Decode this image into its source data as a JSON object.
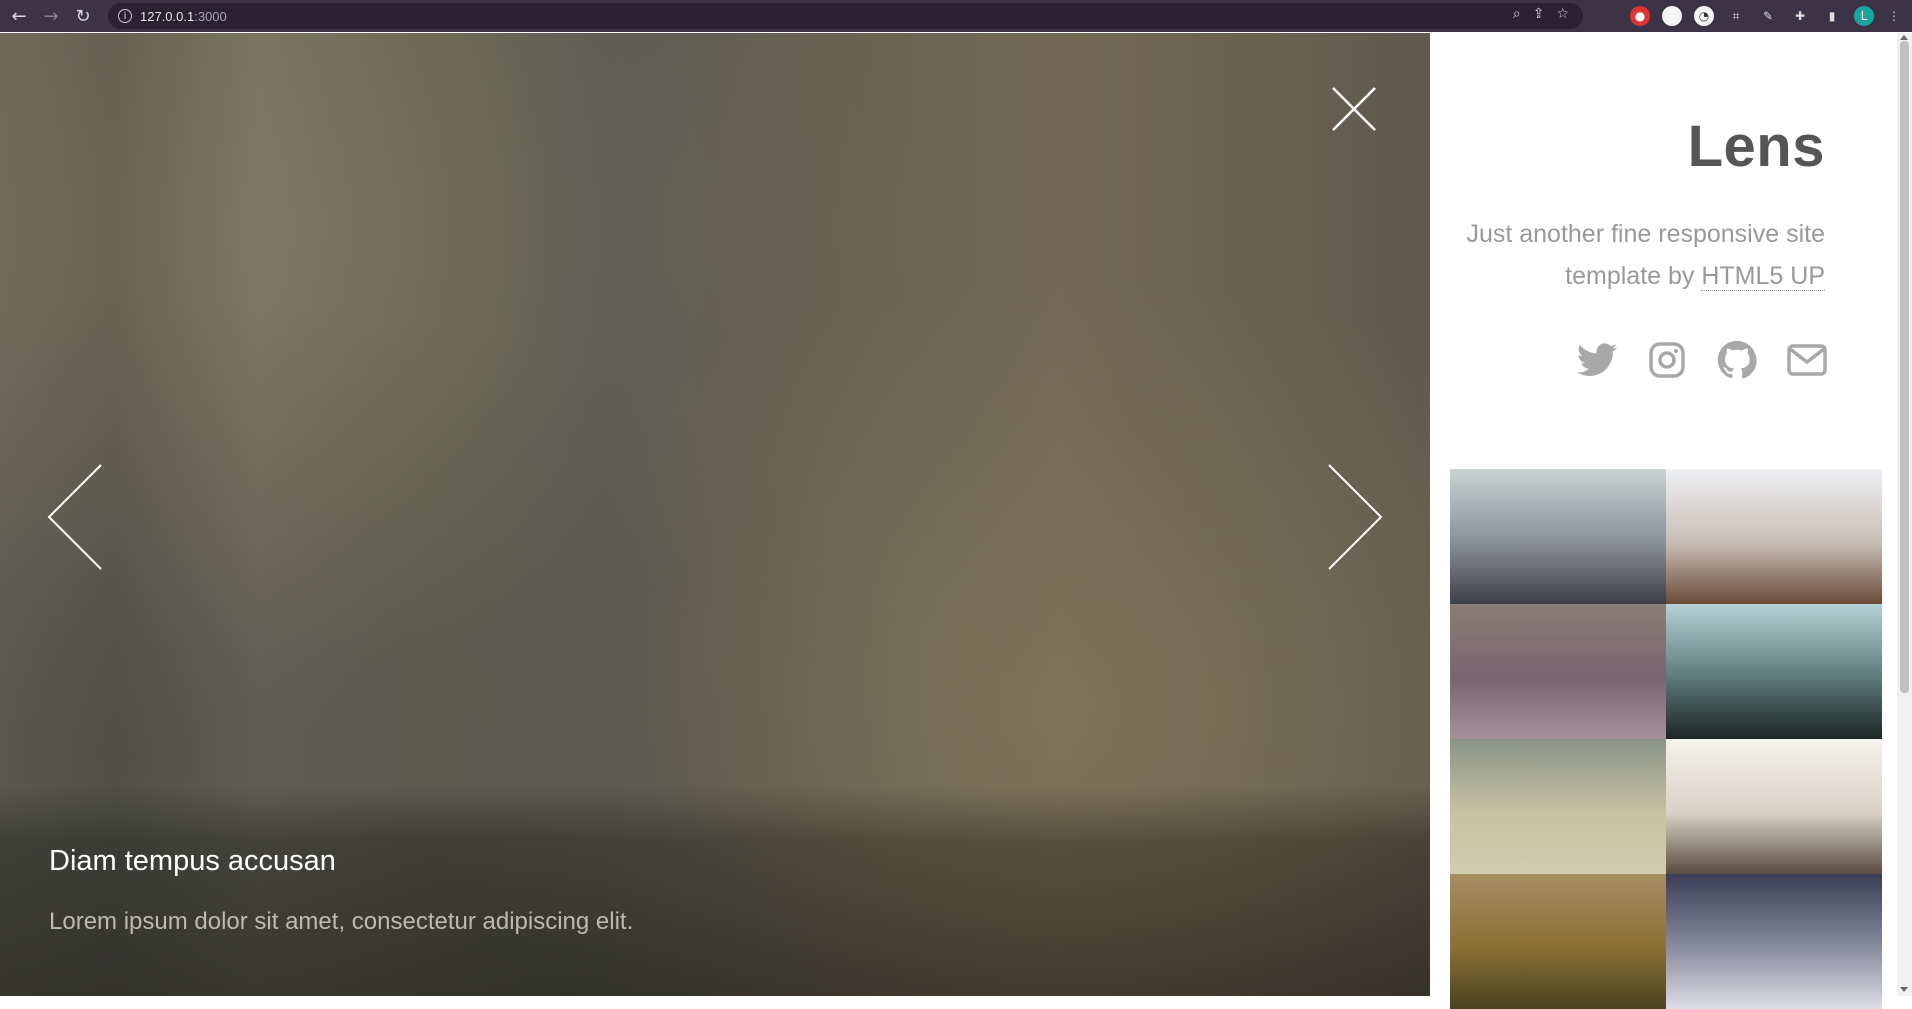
{
  "browser": {
    "url_host": "127.0.0.1",
    "url_port": ":3000",
    "profile_initial": "L"
  },
  "viewer": {
    "caption_title": "Diam tempus accusan",
    "caption_text": "Lorem ipsum dolor sit amet, consectetur adipiscing elit."
  },
  "sidebar": {
    "title": "Lens",
    "tagline_prefix": "Just another fine responsive site template by ",
    "tagline_link": "HTML5 UP",
    "socials": [
      "twitter-icon",
      "instagram-icon",
      "github-icon",
      "envelope-icon"
    ]
  },
  "thumbnails": [
    {
      "top": "#c8d4d2",
      "mid": "#8a8e98",
      "bottom": "#3d3f47"
    },
    {
      "top": "#eef0f4",
      "mid": "#c8bdb5",
      "bottom": "#6a4a36"
    },
    {
      "top": "#8a7e78",
      "mid": "#7a6470",
      "bottom": "#a8909a"
    },
    {
      "top": "#b4d2d6",
      "mid": "#5c7a78",
      "bottom": "#1c2624"
    },
    {
      "top": "#8a9488",
      "mid": "#c7c2a2",
      "bottom": "#d2cbb0"
    },
    {
      "top": "#f4f2ee",
      "mid": "#d8d0c4",
      "bottom": "#5a4c40"
    },
    {
      "top": "#a68e62",
      "mid": "#8a7034",
      "bottom": "#4a4220"
    },
    {
      "top": "#3a3d55",
      "mid": "#8a8ca0",
      "bottom": "#dcdde4"
    }
  ]
}
